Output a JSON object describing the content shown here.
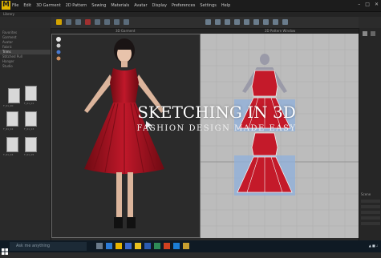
{
  "app": {
    "logo": "M",
    "menu": [
      "File",
      "Edit",
      "3D Garment",
      "2D Pattern",
      "Sewing",
      "Materials",
      "Avatar",
      "Display",
      "Preferences",
      "Settings",
      "Help"
    ]
  },
  "tabs": {
    "view3d_tab": "3D Garment",
    "view2d_tab": "2D Pattern Window",
    "left_tab": "Library"
  },
  "sidebar": {
    "items": [
      "Favorites",
      "Garment",
      "Avatar",
      "Fabric",
      "Trims",
      "Stitched Pull",
      "Hanger",
      "Studio"
    ],
    "selected_index": 4
  },
  "thumbnails": [
    {
      "caption": "F_01_00"
    },
    {
      "caption": "F_01_01"
    },
    {
      "caption": "F_01_02"
    },
    {
      "caption": "F_01_03"
    },
    {
      "caption": "F_01_04"
    },
    {
      "caption": "F_01_05"
    }
  ],
  "overlay": {
    "headline": "SKETCHING IN 3D",
    "subheadline": "FASHION DESIGN MADE EASY"
  },
  "right_panel": {
    "title": "Scene"
  },
  "taskbar": {
    "search_placeholder": "Ask me anything"
  },
  "colors": {
    "accent": "#e0b400",
    "dress": "#b01420",
    "pattern_bg": "#bcbcbc",
    "pattern_highlight": "#8fb0dc"
  }
}
